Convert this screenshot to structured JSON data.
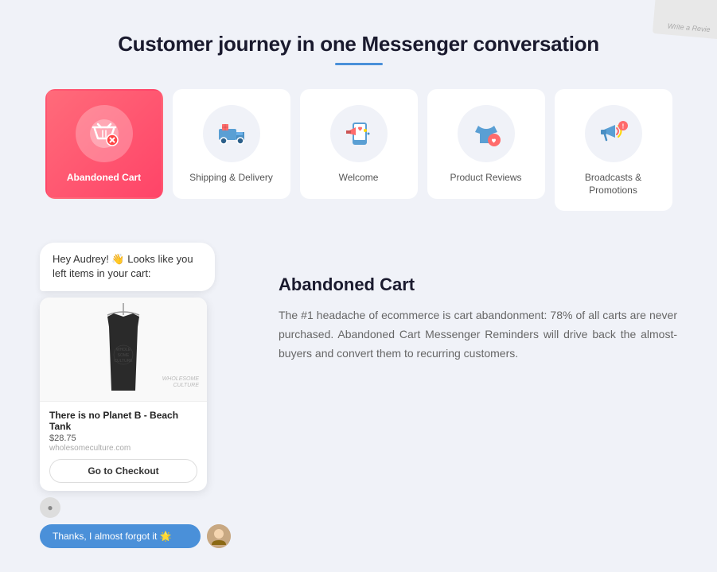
{
  "page": {
    "title": "Customer journey in one Messenger conversation"
  },
  "cards": [
    {
      "id": "abandoned-cart",
      "label": "Abandoned Cart",
      "active": true
    },
    {
      "id": "shipping-delivery",
      "label": "Shipping & Delivery",
      "active": false
    },
    {
      "id": "welcome",
      "label": "Welcome",
      "active": false
    },
    {
      "id": "product-reviews",
      "label": "Product Reviews",
      "active": false
    },
    {
      "id": "broadcasts-promotions",
      "label": "Broadcasts & Promotions",
      "active": false
    }
  ],
  "chat": {
    "bubble_text": "Hey Audrey! 👋 Looks like you left items in your cart:",
    "product_title": "There is no Planet B - Beach Tank",
    "product_price": "$28.75",
    "product_url": "wholesomeculture.com",
    "checkout_btn": "Go to Checkout",
    "reply_text": "Thanks, I almost forgot it 🌟"
  },
  "detail": {
    "title": "Abandoned Cart",
    "description": "The #1 headache of ecommerce is cart abandonment: 78% of all carts are never purchased. Abandoned Cart Messenger Reminders will drive back the almost-buyers and convert them to recurring customers."
  },
  "corner": {
    "text": "Write a Revie"
  }
}
